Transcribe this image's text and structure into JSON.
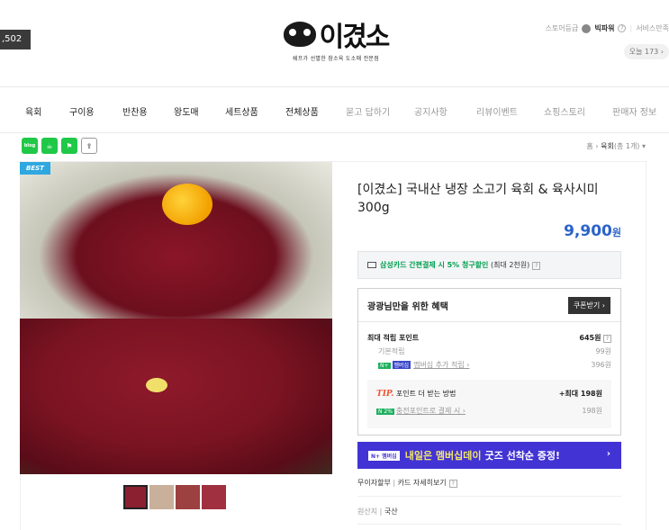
{
  "left_badge": ",502",
  "logo": {
    "word": "이겼소",
    "tagline": "쉐프가 선별한 참소육 도소매 전문점"
  },
  "top_right": {
    "grade_label": "스토어등급",
    "power": "빅파워",
    "help": "?",
    "service": "서비스만족",
    "today": "오늘 173 ›"
  },
  "nav": {
    "items": [
      {
        "label": "육회",
        "dim": false
      },
      {
        "label": "구이용",
        "dim": false
      },
      {
        "label": "반찬용",
        "dim": false
      },
      {
        "label": "왕도매",
        "dim": false
      },
      {
        "label": "세트상품",
        "dim": false
      },
      {
        "label": "전체상품",
        "dim": false
      },
      {
        "label": "묻고 답하기",
        "dim": true
      },
      {
        "label": "공지사항",
        "dim": true
      },
      {
        "label": "리뷰이벤트",
        "dim": true
      },
      {
        "label": "쇼핑스토리",
        "dim": true
      },
      {
        "label": "판매자 정보",
        "dim": true
      }
    ]
  },
  "share": {
    "blog": "blog",
    "share_icon": "⇪"
  },
  "breadcrumb": {
    "home": "홈",
    "sep": "›",
    "current": "육회",
    "count": "(총 1개)",
    "caret": "▾"
  },
  "product": {
    "badge": "BEST",
    "title": "[이겼소] 국내산 냉장 소고기 육회 & 육사시미 300g",
    "price": "9,900",
    "price_unit": "원"
  },
  "discount": {
    "green": "삼성카드 간편결제 시 5% 청구할인",
    "rest": "(최대 2천원)",
    "help": "?"
  },
  "benefit": {
    "heading": "광광님만을 위한 혜택",
    "coupon": "쿠폰받기 ›",
    "max_points_label": "최대 적립 포인트",
    "max_points_value": "645원",
    "max_points_help": "?",
    "basic_label": "기본적립",
    "basic_value": "99원",
    "membership_badge": "N+",
    "membership_badge2": "멤버십",
    "membership_label": "멤버십 추가 적립 ›",
    "membership_value": "396원",
    "tip_label": "TIP.",
    "tip_text": "포인트 더 받는 방법",
    "tip_max": "+최대 198원",
    "charge_badge": "N 2%",
    "charge_label": "충전포인트로 결제 시 ›",
    "charge_value": "198원"
  },
  "banner": {
    "tag": "N+ 멤버십",
    "highlight": "내일은 멤버십데이",
    "text": "굿즈 선착순 증정!",
    "arrow": "›"
  },
  "installment": {
    "label": "무이자할부",
    "link": "카드 자세히보기",
    "help": "?"
  },
  "origin": {
    "label": "원산지",
    "value": "국산"
  }
}
